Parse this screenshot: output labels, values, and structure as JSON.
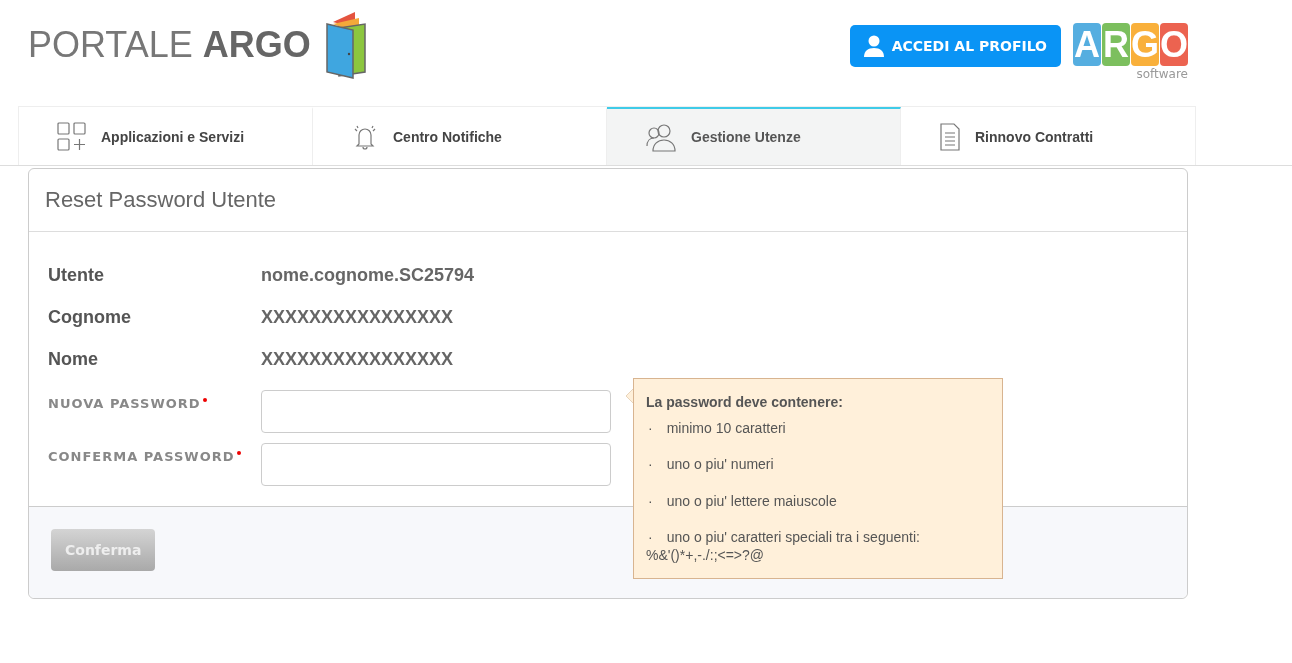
{
  "header": {
    "logo_text": "PORTALE",
    "logo_bold": "ARGO",
    "profile_button": "ACCEDI AL PROFILO",
    "brand_letters": [
      {
        "letter": "A",
        "color": "#55aee0"
      },
      {
        "letter": "R",
        "color": "#7cbf5e"
      },
      {
        "letter": "G",
        "color": "#f9b03b"
      },
      {
        "letter": "O",
        "color": "#ec6350"
      }
    ],
    "brand_sub": "software"
  },
  "tabs": [
    {
      "label": "Applicazioni e Servizi",
      "kind": "apps",
      "selected": false
    },
    {
      "label": "Centro Notifiche",
      "kind": "notifications",
      "selected": false
    },
    {
      "label": "Gestione Utenze",
      "kind": "users",
      "selected": true
    },
    {
      "label": "Rinnovo Contratti",
      "kind": "contracts",
      "selected": false
    }
  ],
  "card": {
    "title": "Reset Password Utente",
    "info": [
      {
        "label": "Utente",
        "value": "nome.cognome.SC25794"
      },
      {
        "label": "Cognome",
        "value": "XXXXXXXXXXXXXXXX"
      },
      {
        "label": "Nome",
        "value": "XXXXXXXXXXXXXXXX"
      }
    ],
    "fields": [
      {
        "label": "NUOVA PASSWORD",
        "required": true
      },
      {
        "label": "CONFERMA PASSWORD",
        "required": true
      }
    ],
    "confirm_button": {
      "label": "Conferma",
      "disabled": true
    }
  },
  "tooltip": {
    "title": "La password deve contenere:",
    "items": [
      {
        "bullet": "·",
        "text": "minimo 10 caratteri"
      },
      {
        "bullet": "·",
        "text": "uno o piu' numeri"
      },
      {
        "bullet": "·",
        "text": "uno o piu' lettere maiuscole"
      },
      {
        "bullet": "·",
        "text": "uno o piu' caratteri speciali tra i seguenti: %&'()*+,-./:;<=>?@"
      }
    ]
  }
}
